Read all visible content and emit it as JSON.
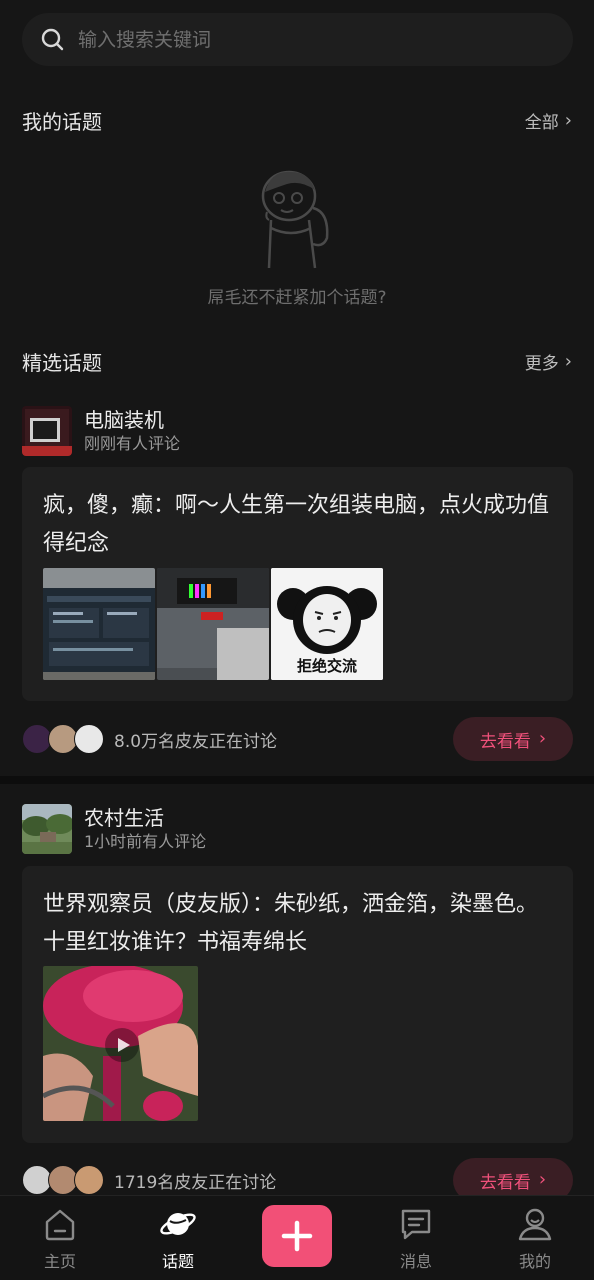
{
  "search": {
    "placeholder": "输入搜索关键词"
  },
  "my_topics": {
    "title": "我的话题",
    "all_label": "全部",
    "empty_text": "屌毛还不赶紧加个话题?"
  },
  "featured": {
    "title": "精选话题",
    "more_label": "更多"
  },
  "topics": [
    {
      "name": "电脑装机",
      "sub": "刚刚有人评论",
      "post_title": "疯，傻，癫：啊～人生第一次组装电脑，点火成功值得纪念",
      "images": [
        "screenshot",
        "pc-case",
        "meme"
      ],
      "meme_caption": "拒绝交流",
      "discuss_text": "8.0万名皮友正在讨论",
      "button_label": "去看看"
    },
    {
      "name": "农村生活",
      "sub": "1小时前有人评论",
      "post_title": "世界观察员（皮友版）：朱砂纸，洒金箔，染墨色。十里红妆谁许？书福寿绵长",
      "images": [
        "video-flower"
      ],
      "discuss_text": "1719名皮友正在讨论",
      "button_label": "去看看"
    }
  ],
  "tabbar": {
    "items": [
      {
        "label": "主页",
        "icon": "home-icon",
        "active": false
      },
      {
        "label": "话题",
        "icon": "planet-icon",
        "active": true
      },
      {
        "label": "",
        "icon": "plus-icon",
        "active": false
      },
      {
        "label": "消息",
        "icon": "message-icon",
        "active": false
      },
      {
        "label": "我的",
        "icon": "profile-icon",
        "active": false
      }
    ]
  },
  "colors": {
    "accent": "#f25077",
    "background": "#161616",
    "card": "#1f1f1f"
  }
}
